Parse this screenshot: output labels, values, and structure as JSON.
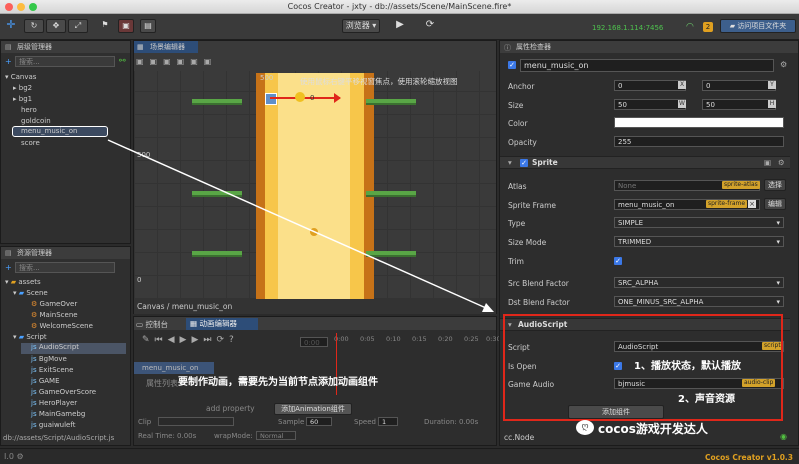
{
  "window": {
    "title": "Cocos Creator - jxty - db://assets/Scene/MainScene.fire*"
  },
  "toolbar": {
    "browser_label": "浏览器",
    "ip": "192.168.1.114:7456",
    "badge": "2",
    "open_folder": "访问项目文件夹"
  },
  "hierarchy": {
    "title": "层级管理器",
    "search_placeholder": "搜索...",
    "items": [
      "Canvas",
      "bg2",
      "bg1",
      "hero",
      "goldcoin",
      "menu_music_on",
      "score"
    ]
  },
  "assets": {
    "title": "资源管理器",
    "search_placeholder": "搜索...",
    "items": [
      "assets",
      "Scene",
      "GameOver",
      "MainScene",
      "WelcomeScene",
      "Script",
      "AudioScript",
      "BgMove",
      "ExitScene",
      "GAME",
      "GameOverScore",
      "HeroPlayer",
      "MainGamebg",
      "guaiwuleft"
    ],
    "footer_path": "db://assets/Script/AudioScript.js"
  },
  "scene": {
    "title": "场景编辑器",
    "hint": "使用鼠标右键平移视窗焦点，使用滚轮缩放视图",
    "label_500_top": "500",
    "label_500_left": "500",
    "label_0": "0",
    "coin_count": "0",
    "breadcrumb": "Canvas / menu_music_on"
  },
  "bottom": {
    "tab_console": "控制台",
    "tab_anim": "动画编辑器",
    "time": "0:00",
    "node_row": "menu_music_on",
    "prop_row": "属性列表",
    "add_property": "add property",
    "add_anim_button": "添加Animation组件",
    "clip_label": "Clip",
    "sample_label": "Sample",
    "sample_val": "60",
    "speed_label": "Speed",
    "speed_val": "1",
    "duration_label": "Duration: 0.00s",
    "realtime_label": "Real Time: 0.00s",
    "wrapmode_label": "wrapMode:",
    "wrapmode_val": "Normal",
    "ticks": [
      "0:00",
      "0:05",
      "0:10",
      "0:15",
      "0:20",
      "0:25",
      "0:30"
    ]
  },
  "inspector": {
    "title": "属性检查器",
    "node_name": "menu_music_on",
    "anchor_label": "Anchor",
    "anchor_x": "0",
    "anchor_y": "0",
    "size_label": "Size",
    "size_w": "50",
    "size_h": "50",
    "color_label": "Color",
    "opacity_label": "Opacity",
    "opacity": "255",
    "sprite_section": "Sprite",
    "atlas_label": "Atlas",
    "atlas_val": "None",
    "atlas_tag": "sprite-atlas",
    "choose_btn": "选择",
    "sprite_frame_label": "Sprite Frame",
    "sprite_frame_val": "menu_music_on",
    "sprite_frame_tag": "sprite-frame",
    "edit_btn": "编辑",
    "type_label": "Type",
    "type_val": "SIMPLE",
    "size_mode_label": "Size Mode",
    "size_mode_val": "TRIMMED",
    "trim_label": "Trim",
    "src_blend_label": "Src Blend Factor",
    "src_blend_val": "SRC_ALPHA",
    "dst_blend_label": "Dst Blend Factor",
    "dst_blend_val": "ONE_MINUS_SRC_ALPHA",
    "audio_section": "AudioScript",
    "script_label": "Script",
    "script_val": "AudioScript",
    "script_tag": "script",
    "isopen_label": "Is Open",
    "audio_label": "Game Audio",
    "audio_val": "bjmusic",
    "audio_tag": "audio-clip",
    "add_component": "添加组件",
    "footer": "cc.Node"
  },
  "annotations": {
    "anim_hint": "要制作动画，需要先为当前节点添加动画组件",
    "note1": "1、播放状态，默认播放",
    "note2": "2、声音资源",
    "watermark": "cocos游戏开发达人"
  },
  "statusbar": {
    "version": "Cocos Creator v1.0.3"
  },
  "colors": {
    "highlight": "#e0271a",
    "accent": "#3b78e7",
    "tag": "#d3a22a"
  }
}
